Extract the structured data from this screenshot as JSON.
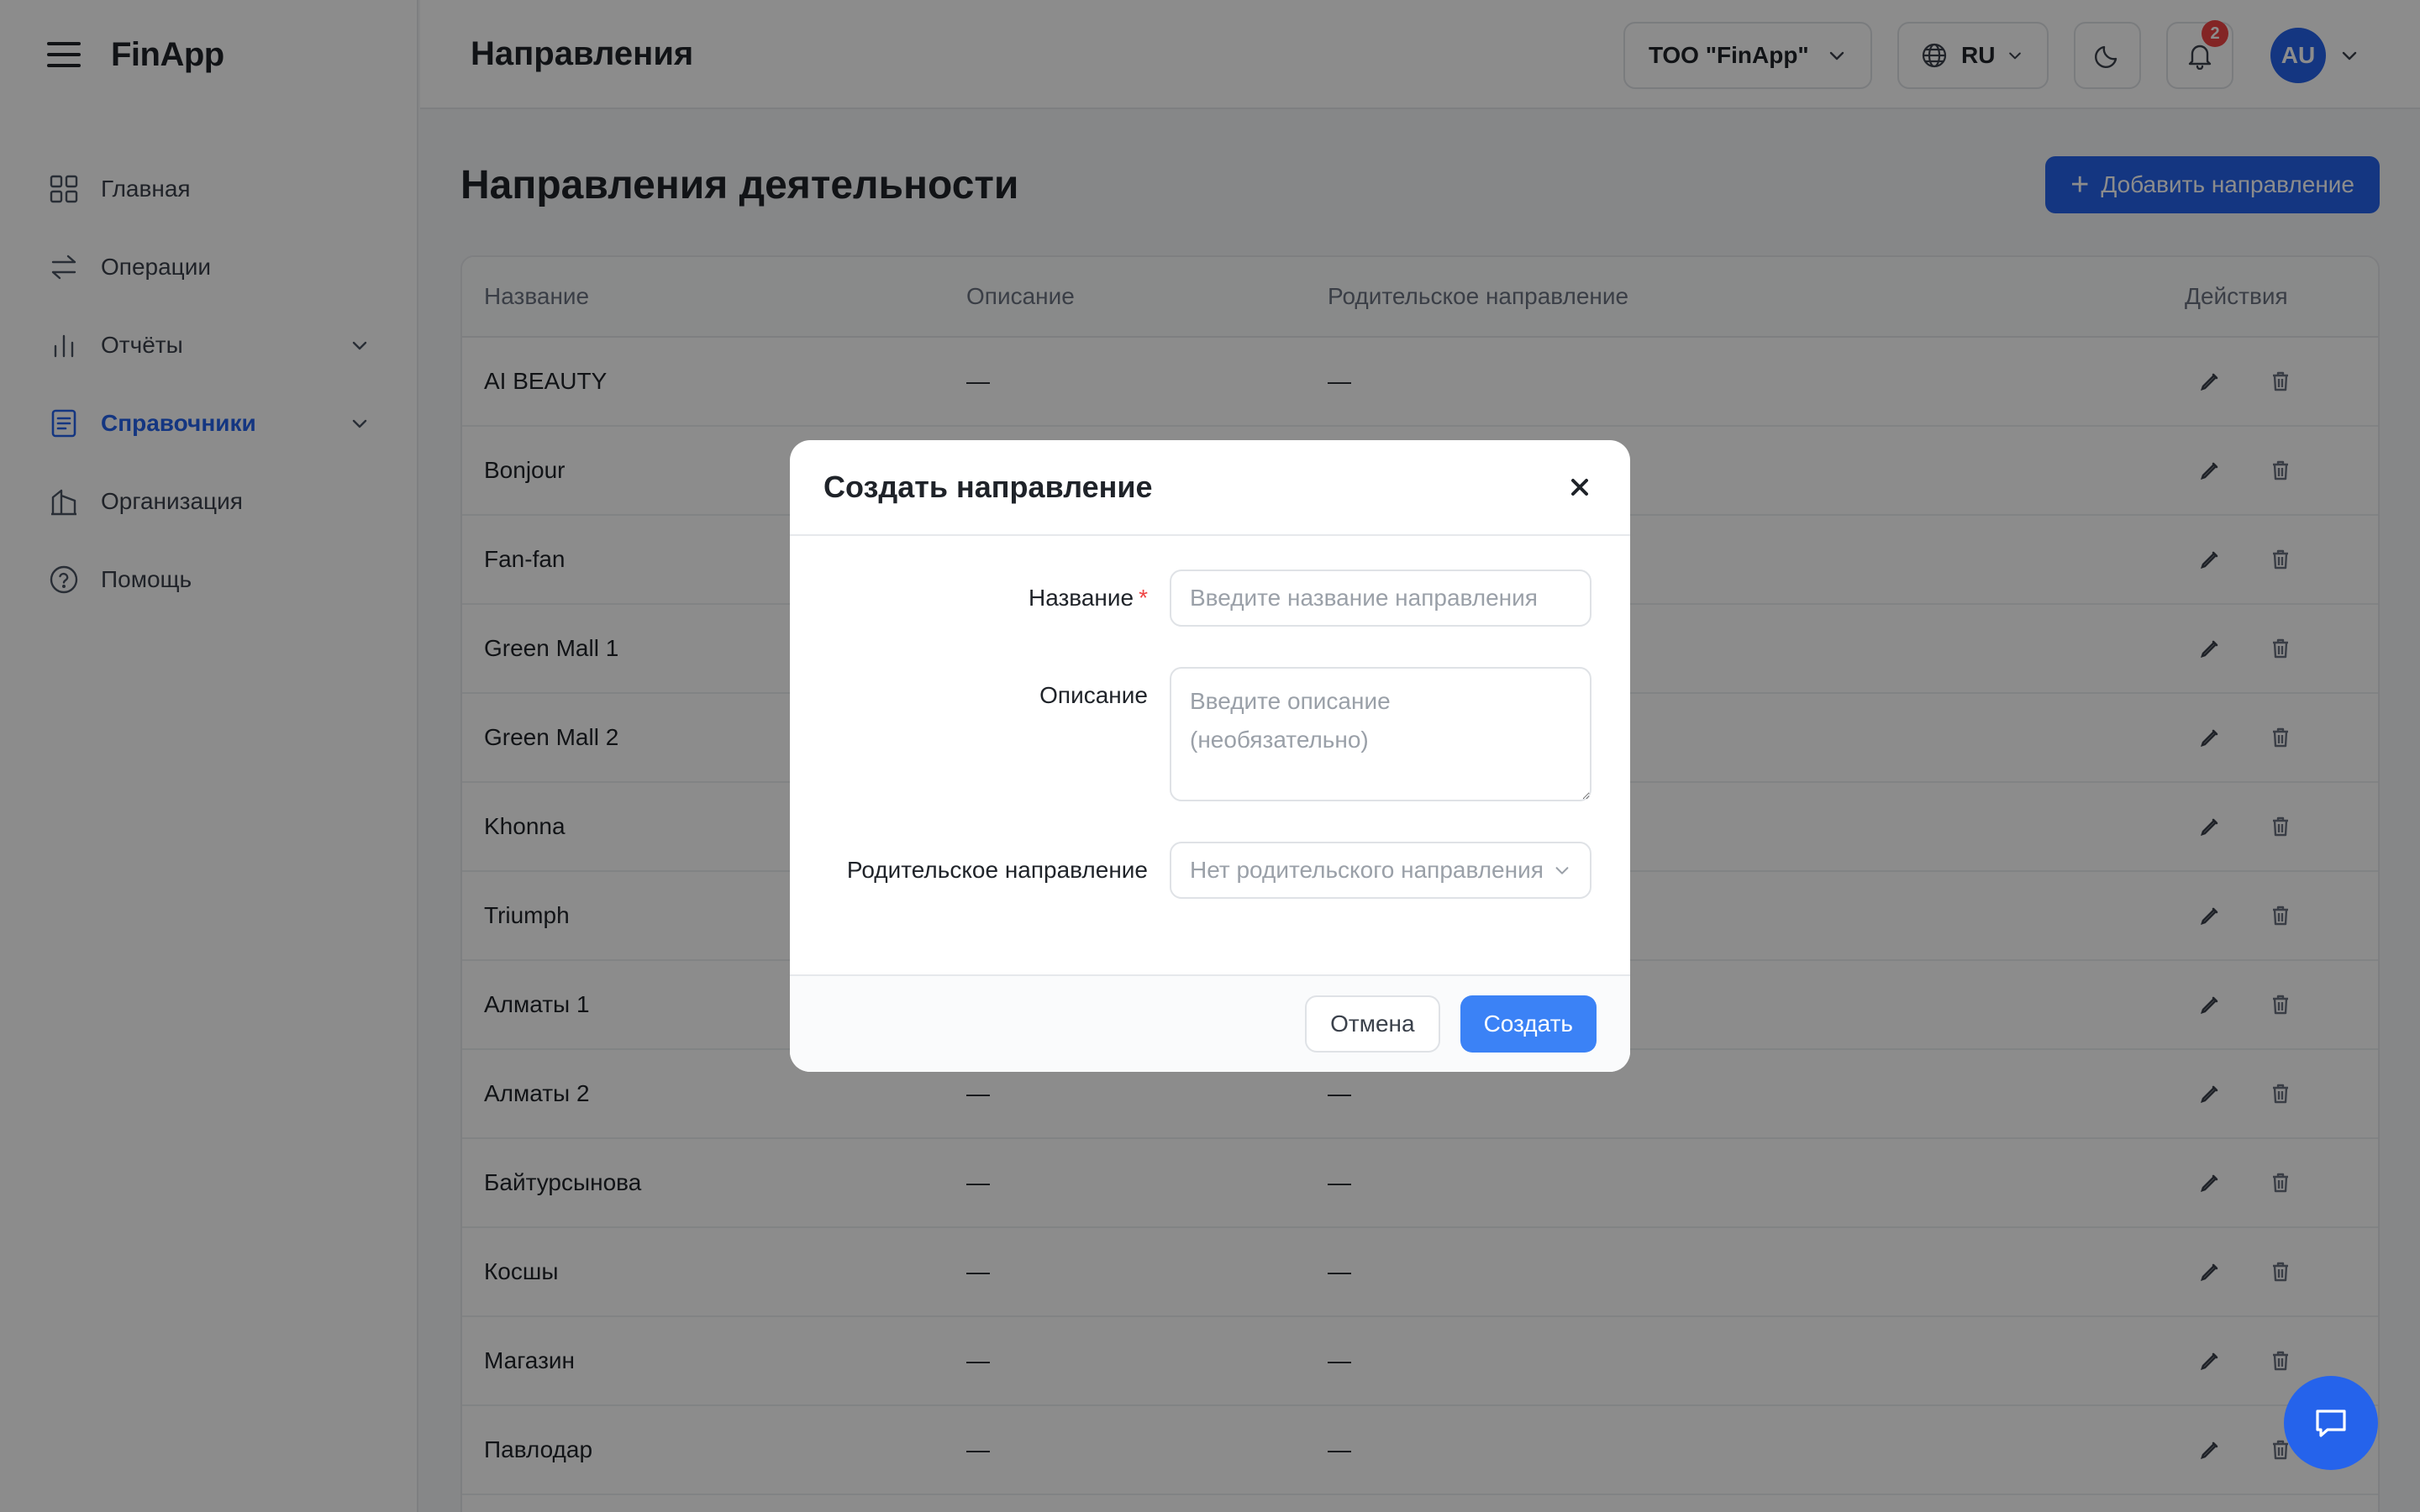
{
  "app": {
    "logo": "FinApp"
  },
  "sidebar": {
    "items": [
      {
        "label": "Главная",
        "icon": "grid-icon"
      },
      {
        "label": "Операции",
        "icon": "transfer-icon"
      },
      {
        "label": "Отчёты",
        "icon": "bar-chart-icon",
        "expandable": true
      },
      {
        "label": "Справочники",
        "icon": "book-icon",
        "expandable": true,
        "active": true
      },
      {
        "label": "Организация",
        "icon": "building-icon"
      },
      {
        "label": "Помощь",
        "icon": "help-circle-icon"
      }
    ]
  },
  "header": {
    "title": "Направления",
    "org": "ТОО \"FinApp\"",
    "lang": "RU",
    "notifications": "2",
    "avatar": "AU"
  },
  "main": {
    "title": "Направления деятельности",
    "add_button": "Добавить направление",
    "columns": [
      "Название",
      "Описание",
      "Родительское направление",
      "Действия"
    ],
    "rows": [
      {
        "name": "AI BEAUTY",
        "desc": "—",
        "parent": "—"
      },
      {
        "name": "Bonjour",
        "desc": "",
        "parent": ""
      },
      {
        "name": "Fan-fan",
        "desc": "",
        "parent": ""
      },
      {
        "name": "Green Mall 1",
        "desc": "",
        "parent": ""
      },
      {
        "name": "Green Mall 2",
        "desc": "",
        "parent": ""
      },
      {
        "name": "Khonna",
        "desc": "",
        "parent": ""
      },
      {
        "name": "Triumph",
        "desc": "",
        "parent": ""
      },
      {
        "name": "Алматы 1",
        "desc": "",
        "parent": ""
      },
      {
        "name": "Алматы 2",
        "desc": "—",
        "parent": "—"
      },
      {
        "name": "Байтурсынова",
        "desc": "—",
        "parent": "—"
      },
      {
        "name": "Косшы",
        "desc": "—",
        "parent": "—"
      },
      {
        "name": "Магазин",
        "desc": "—",
        "parent": "—"
      },
      {
        "name": "Павлодар",
        "desc": "—",
        "parent": "—"
      }
    ]
  },
  "modal": {
    "title": "Создать направление",
    "name_label": "Название",
    "required_mark": "*",
    "name_placeholder": "Введите название направления",
    "desc_label": "Описание",
    "desc_placeholder": "Введите описание (необязательно)",
    "parent_label": "Родительское направление",
    "parent_value": "Нет родительского направления",
    "cancel": "Отмена",
    "create": "Создать"
  },
  "colors": {
    "accent": "#2563eb",
    "create_button": "#3b82f6",
    "badge": "#ef4444"
  }
}
